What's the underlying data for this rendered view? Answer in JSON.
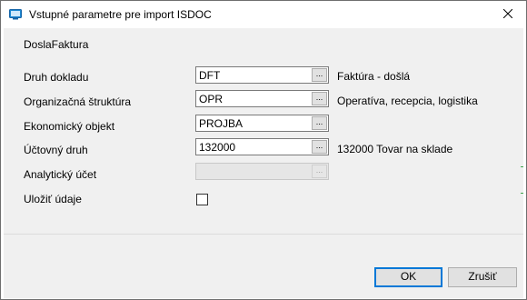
{
  "window": {
    "title": "Vstupné parametre pre import ISDOC"
  },
  "header": {
    "text": "DoslaFaktura"
  },
  "fields": [
    {
      "label": "Druh dokladu",
      "value": "DFT",
      "lookup_label": "...",
      "description": "Faktúra - došlá"
    },
    {
      "label": "Organizačná štruktúra",
      "value": "OPR",
      "lookup_label": "...",
      "description": "Operatíva, recepcia, logistika"
    },
    {
      "label": "Ekonomický objekt",
      "value": "PROJBA",
      "lookup_label": "...",
      "description": ""
    },
    {
      "label": "Účtovný druh",
      "value": "132000",
      "lookup_label": "...",
      "description": "132000 Tovar na sklade"
    },
    {
      "label": "Analytický účet",
      "value": "",
      "lookup_label": "...",
      "description": "",
      "disabled": true
    }
  ],
  "save": {
    "label": "Uložiť údaje",
    "checked": false
  },
  "buttons": {
    "ok": "OK",
    "cancel": "Zrušiť"
  },
  "colors": {
    "accent": "#0078d7",
    "app_icon": "#1e88d2"
  },
  "icons": {
    "app": "app-window-icon",
    "close": "close-icon"
  }
}
